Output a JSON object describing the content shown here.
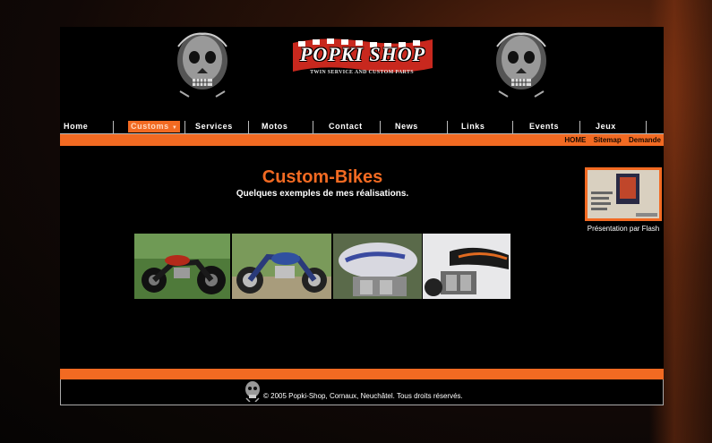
{
  "header": {
    "logo_text": "POPKI SHOP",
    "logo_tagline": "TWIN SERVICE AND CUSTOM PARTS"
  },
  "nav": {
    "items": [
      "Home",
      "Customs",
      "Services",
      "Motos",
      "Contact",
      "News",
      "Links",
      "Events",
      "Jeux"
    ],
    "active": "Customs"
  },
  "sub_nav": {
    "home": "HOME",
    "sitemap": "Sitemap",
    "demande": "Demande"
  },
  "main": {
    "title": "Custom-Bikes",
    "subtitle": "Quelques exemples de mes réalisations."
  },
  "flash": {
    "label": "Présentation par Flash"
  },
  "footer": {
    "copyright": "© 2005 Popki-Shop, Cornaux, Neuchâtel. Tous droits réservés."
  },
  "colors": {
    "accent": "#f26a22",
    "background": "#000000"
  }
}
